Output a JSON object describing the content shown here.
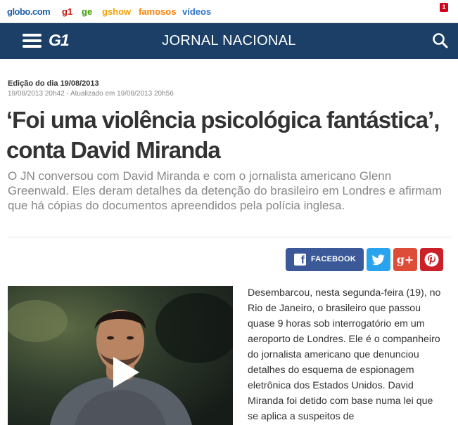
{
  "globo_bar": {
    "links": {
      "globo": "globo.com",
      "g1": "g1",
      "ge": "ge",
      "gshow": "gshow",
      "famosos": "famosos",
      "videos": "vídeos"
    },
    "notification_count": "1"
  },
  "header": {
    "logo": "G1",
    "title": "JORNAL NACIONAL"
  },
  "article": {
    "edition": "Edição do dia 19/08/2013",
    "timestamp": "19/08/2013 20h42 - Atualizado em 19/08/2013 20h56",
    "headline": "‘Foi uma violência psicológica fantástica’, conta David Miranda",
    "subtitle": "O JN conversou com David Miranda e com o jornalista americano Glenn Greenwald. Eles deram detalhes da detenção do brasileiro em Londres e afirmam que há cópias do documentos apreendidos pela polícia inglesa.",
    "body": "Desembarcou, nesta segunda-feira (19), no Rio de Janeiro, o brasileiro que passou quase 9 horas sob interrogatório em um aeroporto de Londres. Ele é o companheiro do jornalista americano que denunciou detalhes do esquema de espionagem eletrônica dos Estados Unidos. David Miranda foi detido com base numa lei que se aplica a suspeitos de"
  },
  "share": {
    "facebook_label": "FACEBOOK"
  },
  "icons": {
    "menu": "hamburger-menu-icon",
    "search": "magnifier-search-icon",
    "facebook": "facebook-f-icon",
    "twitter": "twitter-bird-icon",
    "google_plus": "google-plus-icon",
    "pinterest": "pinterest-p-icon",
    "play": "play-triangle-icon"
  },
  "colors": {
    "header_bg": "#1b3f66",
    "facebook": "#3b5998",
    "twitter": "#2aa3ef",
    "google_plus": "#dd4b39",
    "pinterest": "#cb2027"
  }
}
